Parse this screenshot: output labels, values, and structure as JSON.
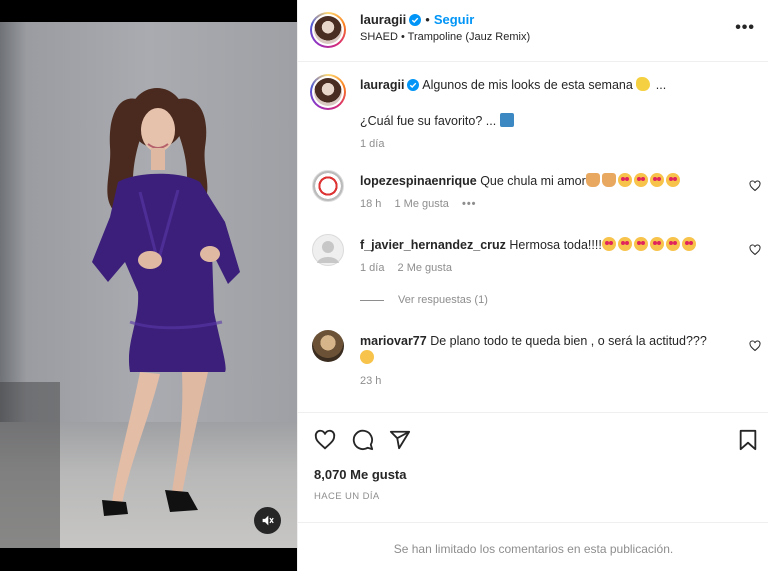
{
  "header": {
    "username": "lauragii",
    "follow_label": "Seguir",
    "separator": "•",
    "audio": "SHAED • Trampoline (Jauz Remix)",
    "more_label": "•••"
  },
  "caption": {
    "username": "lauragii",
    "line1": "Algunos de mis looks de esta semana",
    "line1_suffix": "...",
    "line2": "¿Cuál fue su favorito? ...",
    "time": "1 día"
  },
  "comments": [
    {
      "username": "lopezespinaenrique",
      "text": "Que chula mi amor",
      "emojis": [
        "pray",
        "pray",
        "love",
        "love",
        "love",
        "love"
      ],
      "time": "18 h",
      "likes": "1 Me gusta",
      "more": "•••"
    },
    {
      "username": "f_javier_hernandez_cruz",
      "text": "Hermosa toda!!!!",
      "emojis": [
        "love",
        "love",
        "love",
        "love",
        "love",
        "love"
      ],
      "time": "1 día",
      "likes": "2 Me gusta",
      "replies": "Ver respuestas (1)"
    },
    {
      "username": "mariovar77",
      "text": "De plano todo te queda bien , o será la actitud???",
      "emojis": [
        "think"
      ],
      "time": "23 h"
    }
  ],
  "actions": {
    "likes": "8,070 Me gusta",
    "posted": "HACE UN DÍA"
  },
  "footer": {
    "limited": "Se han limitado los comentarios en esta publicación."
  },
  "colors": {
    "accent": "#0095f6",
    "verified": "#0095f6",
    "muted": "#8e8e8e",
    "dress": "#3b1f7a"
  }
}
